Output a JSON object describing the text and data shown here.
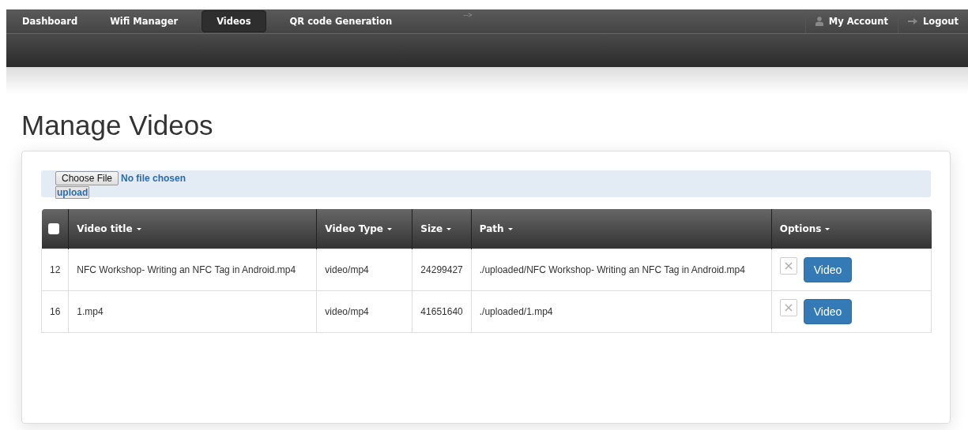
{
  "nav": {
    "tabs": [
      {
        "label": "Dashboard",
        "selected": false
      },
      {
        "label": "Wifi Manager",
        "selected": false
      },
      {
        "label": "Videos",
        "selected": true
      },
      {
        "label": "QR code Generation",
        "selected": false
      }
    ],
    "stray_text": "-->",
    "account_links": [
      {
        "kind": "account",
        "label": "My Account"
      },
      {
        "kind": "logout",
        "label": "Logout"
      }
    ]
  },
  "page_title": "Manage Videos",
  "upload": {
    "choose_button": "Choose File",
    "file_status": "No file chosen",
    "upload_button": "upload"
  },
  "table": {
    "select_all_checked": false,
    "columns": [
      "Video title",
      "Video Type",
      "Size",
      "Path",
      "Options"
    ],
    "rows": [
      {
        "id": "12",
        "title": "NFC Workshop- Writing an NFC Tag in Android.mp4",
        "type": "video/mp4",
        "size": "24299427",
        "path": "./uploaded/NFC Workshop- Writing an NFC Tag in Android.mp4",
        "button": "Video"
      },
      {
        "id": "16",
        "title": "1.mp4",
        "type": "video/mp4",
        "size": "41651640",
        "path": "./uploaded/1.mp4",
        "button": "Video"
      }
    ]
  }
}
